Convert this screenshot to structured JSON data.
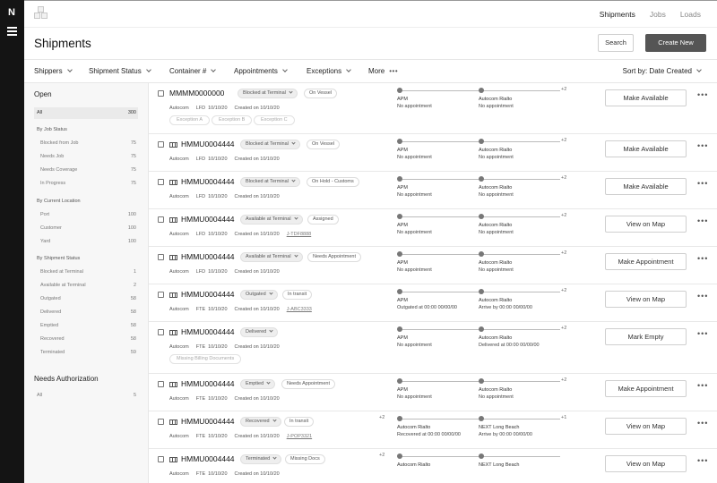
{
  "rail": {
    "logo": "N"
  },
  "topnav": {
    "items": [
      "Shipments",
      "Jobs",
      "Loads"
    ],
    "active": "Shipments"
  },
  "page": {
    "title": "Shipments",
    "search_label": "Search",
    "create_label": "Create New"
  },
  "filters": {
    "items": [
      "Shippers",
      "Shipment Status",
      "Container #",
      "Appointments",
      "Exceptions",
      "More"
    ],
    "sort_label": "Sort by: Date Created"
  },
  "sidebar": {
    "open_title": "Open",
    "all": {
      "label": "All",
      "count": "300"
    },
    "job_status": {
      "title": "By Job Status",
      "items": [
        {
          "label": "Blocked from Job",
          "count": "75"
        },
        {
          "label": "Needs Job",
          "count": "75"
        },
        {
          "label": "Needs Coverage",
          "count": "75"
        },
        {
          "label": "In Progress",
          "count": "75"
        }
      ]
    },
    "location": {
      "title": "By Current Location",
      "items": [
        {
          "label": "Port",
          "count": "100"
        },
        {
          "label": "Customer",
          "count": "100"
        },
        {
          "label": "Yard",
          "count": "100"
        }
      ]
    },
    "shipment_status": {
      "title": "By Shipment Status",
      "items": [
        {
          "label": "Blocked at Terminal",
          "count": "1"
        },
        {
          "label": "Available at Terminal",
          "count": "2"
        },
        {
          "label": "Outgated",
          "count": "58"
        },
        {
          "label": "Delivered",
          "count": "58"
        },
        {
          "label": "Emptied",
          "count": "58"
        },
        {
          "label": "Recovered",
          "count": "58"
        },
        {
          "label": "Terminated",
          "count": "59"
        }
      ]
    },
    "auth_title": "Needs Authorization",
    "auth_all": {
      "label": "All",
      "count": "5"
    }
  },
  "shipments": [
    {
      "id": "MMMM0000000",
      "status": "Blocked at Terminal",
      "tag": "On Vessel",
      "shipper": "Autocom",
      "date_type": "LFD",
      "date": "10/10/20",
      "created": "Created on 10/10/20",
      "ref": "",
      "exceptions": [
        "Exception A",
        "Exception B",
        "Exception C"
      ],
      "pre_more": "",
      "more": "+2",
      "from_name": "APM",
      "from_info": "No appointment",
      "to_name": "Autocom Rialto",
      "to_info": "No appointment",
      "action": "Make Available"
    },
    {
      "id": "HMMU0004444",
      "status": "Blocked at Terminal",
      "tag": "On Vessel",
      "shipper": "Autocom",
      "date_type": "LFD",
      "date": "10/10/20",
      "created": "Created on 10/10/20",
      "ref": "",
      "exceptions": [],
      "pre_more": "",
      "more": "+2",
      "from_name": "APM",
      "from_info": "No appointment",
      "to_name": "Autocom Rialto",
      "to_info": "No appointment",
      "action": "Make Available"
    },
    {
      "id": "HMMU0004444",
      "status": "Blocked at Terminal",
      "tag": "On Hold - Customs",
      "shipper": "Autocom",
      "date_type": "LFD",
      "date": "10/10/20",
      "created": "Created on 10/10/20",
      "ref": "",
      "exceptions": [],
      "pre_more": "",
      "more": "+2",
      "from_name": "APM",
      "from_info": "No appointment",
      "to_name": "Autocom Rialto",
      "to_info": "No appointment",
      "action": "Make Available"
    },
    {
      "id": "HMMU0004444",
      "status": "Available at Terminal",
      "tag": "Assigned",
      "shipper": "Autocom",
      "date_type": "LFD",
      "date": "10/10/20",
      "created": "Created on 10/10/20",
      "ref": "J-TDF8888",
      "exceptions": [],
      "pre_more": "",
      "more": "+2",
      "from_name": "APM",
      "from_info": "No appointment",
      "to_name": "Autocom Rialto",
      "to_info": "No appointment",
      "action": "View on Map"
    },
    {
      "id": "HMMU0004444",
      "status": "Available at Terminal",
      "tag": "Needs Appointment",
      "shipper": "Autocom",
      "date_type": "LFD",
      "date": "10/10/20",
      "created": "Created on 10/10/20",
      "ref": "",
      "exceptions": [],
      "pre_more": "",
      "more": "+2",
      "from_name": "APM",
      "from_info": "No appointment",
      "to_name": "Autocom Rialto",
      "to_info": "No appointment",
      "action": "Make Appointment"
    },
    {
      "id": "HMMU0004444",
      "status": "Outgated",
      "tag": "In transit",
      "shipper": "Autocom",
      "date_type": "FTE",
      "date": "10/10/20",
      "created": "Created on 10/10/20",
      "ref": "J-ABC3333",
      "exceptions": [],
      "pre_more": "",
      "more": "+2",
      "from_name": "APM",
      "from_info": "Outgated at 00:00 00/00/00",
      "to_name": "Autocom Rialto",
      "to_info": "Arrive by 00:00 00/00/00",
      "action": "View on Map"
    },
    {
      "id": "HMMU0004444",
      "status": "Delivered",
      "tag": "",
      "shipper": "Autocom",
      "date_type": "FTE",
      "date": "10/10/20",
      "created": "Created on 10/10/20",
      "ref": "",
      "exceptions": [
        "Missing Billing Documents"
      ],
      "pre_more": "",
      "more": "+2",
      "from_name": "APM",
      "from_info": "No appointment",
      "to_name": "Autocom Rialto",
      "to_info": "Delivered at 00:00 00/00/00",
      "action": "Mark Empty"
    },
    {
      "id": "HMMU0004444",
      "status": "Emptied",
      "tag": "Needs Appointment",
      "shipper": "Autocom",
      "date_type": "FTE",
      "date": "10/10/20",
      "created": "Created on 10/10/20",
      "ref": "",
      "exceptions": [],
      "pre_more": "",
      "more": "+2",
      "from_name": "APM",
      "from_info": "No appointment",
      "to_name": "Autocom Rialto",
      "to_info": "No appointment",
      "action": "Make Appointment"
    },
    {
      "id": "HMMU0004444",
      "status": "Recovered",
      "tag": "In transit",
      "shipper": "Autocom",
      "date_type": "FTE",
      "date": "10/10/20",
      "created": "Created on 10/10/20",
      "ref": "J-POP3321",
      "exceptions": [],
      "pre_more": "+2",
      "more": "+1",
      "from_name": "Autocom Rialto",
      "from_info": "Recovered at 00:00 00/00/00",
      "to_name": "NEXT Long Beach",
      "to_info": "Arrive by 00:00 00/00/00",
      "action": "View on Map"
    },
    {
      "id": "HMMU0004444",
      "status": "Terminated",
      "tag": "Missing Docs",
      "shipper": "Autocom",
      "date_type": "FTE",
      "date": "10/10/20",
      "created": "Created on 10/10/20",
      "ref": "",
      "exceptions": [],
      "pre_more": "+2",
      "more": "",
      "from_name": "Autocom Rialto",
      "from_info": "",
      "to_name": "NEXT Long Beach",
      "to_info": "",
      "action": "View on Map"
    }
  ]
}
